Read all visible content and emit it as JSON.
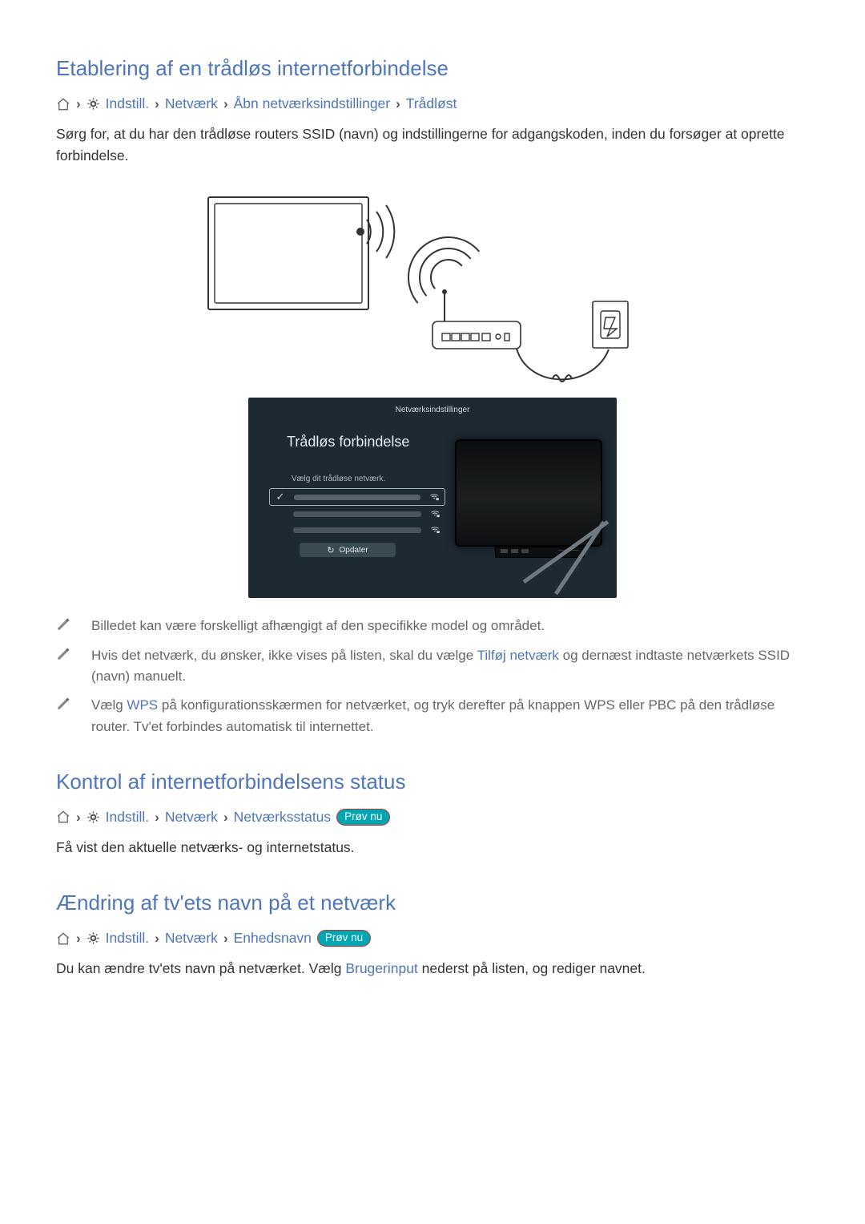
{
  "section1": {
    "title": "Etablering af en trådløs internetforbindelse",
    "nav": {
      "settings": "Indstill.",
      "network": "Netværk",
      "open_settings": "Åbn netværksindstillinger",
      "wireless": "Trådløst"
    },
    "para": "Sørg for, at du har den trådløse routers SSID (navn) og indstillingerne for adgangskoden, inden du forsøger at oprette forbindelse."
  },
  "ui_screenshot": {
    "strip_title": "Netværksindstillinger",
    "panel_title": "Trådløs forbindelse",
    "hint": "Vælg dit trådløse netværk.",
    "refresh_label": "Opdater"
  },
  "notes": {
    "n1": "Billedet kan være forskelligt afhængigt af den specifikke model og området.",
    "n2_a": "Hvis det netværk, du ønsker, ikke vises på listen, skal du vælge ",
    "n2_link": "Tilføj netværk",
    "n2_b": " og dernæst indtaste netværkets SSID (navn) manuelt.",
    "n3_a": "Vælg ",
    "n3_link": "WPS",
    "n3_b": " på konfigurationsskærmen for netværket, og tryk derefter på knappen WPS eller PBC på den trådløse router. Tv'et forbindes automatisk til internettet."
  },
  "section2": {
    "title": "Kontrol af internetforbindelsens status",
    "nav": {
      "settings": "Indstill.",
      "network": "Netværk",
      "status": "Netværksstatus"
    },
    "try_now": "Prøv nu",
    "para": "Få vist den aktuelle netværks- og internetstatus."
  },
  "section3": {
    "title": "Ændring af tv'ets navn på et netværk",
    "nav": {
      "settings": "Indstill.",
      "network": "Netværk",
      "device_name": "Enhedsnavn"
    },
    "try_now": "Prøv nu",
    "para_a": "Du kan ændre tv'ets navn på netværket. Vælg ",
    "para_link": "Brugerinput",
    "para_b": " nederst på listen, og rediger navnet."
  }
}
